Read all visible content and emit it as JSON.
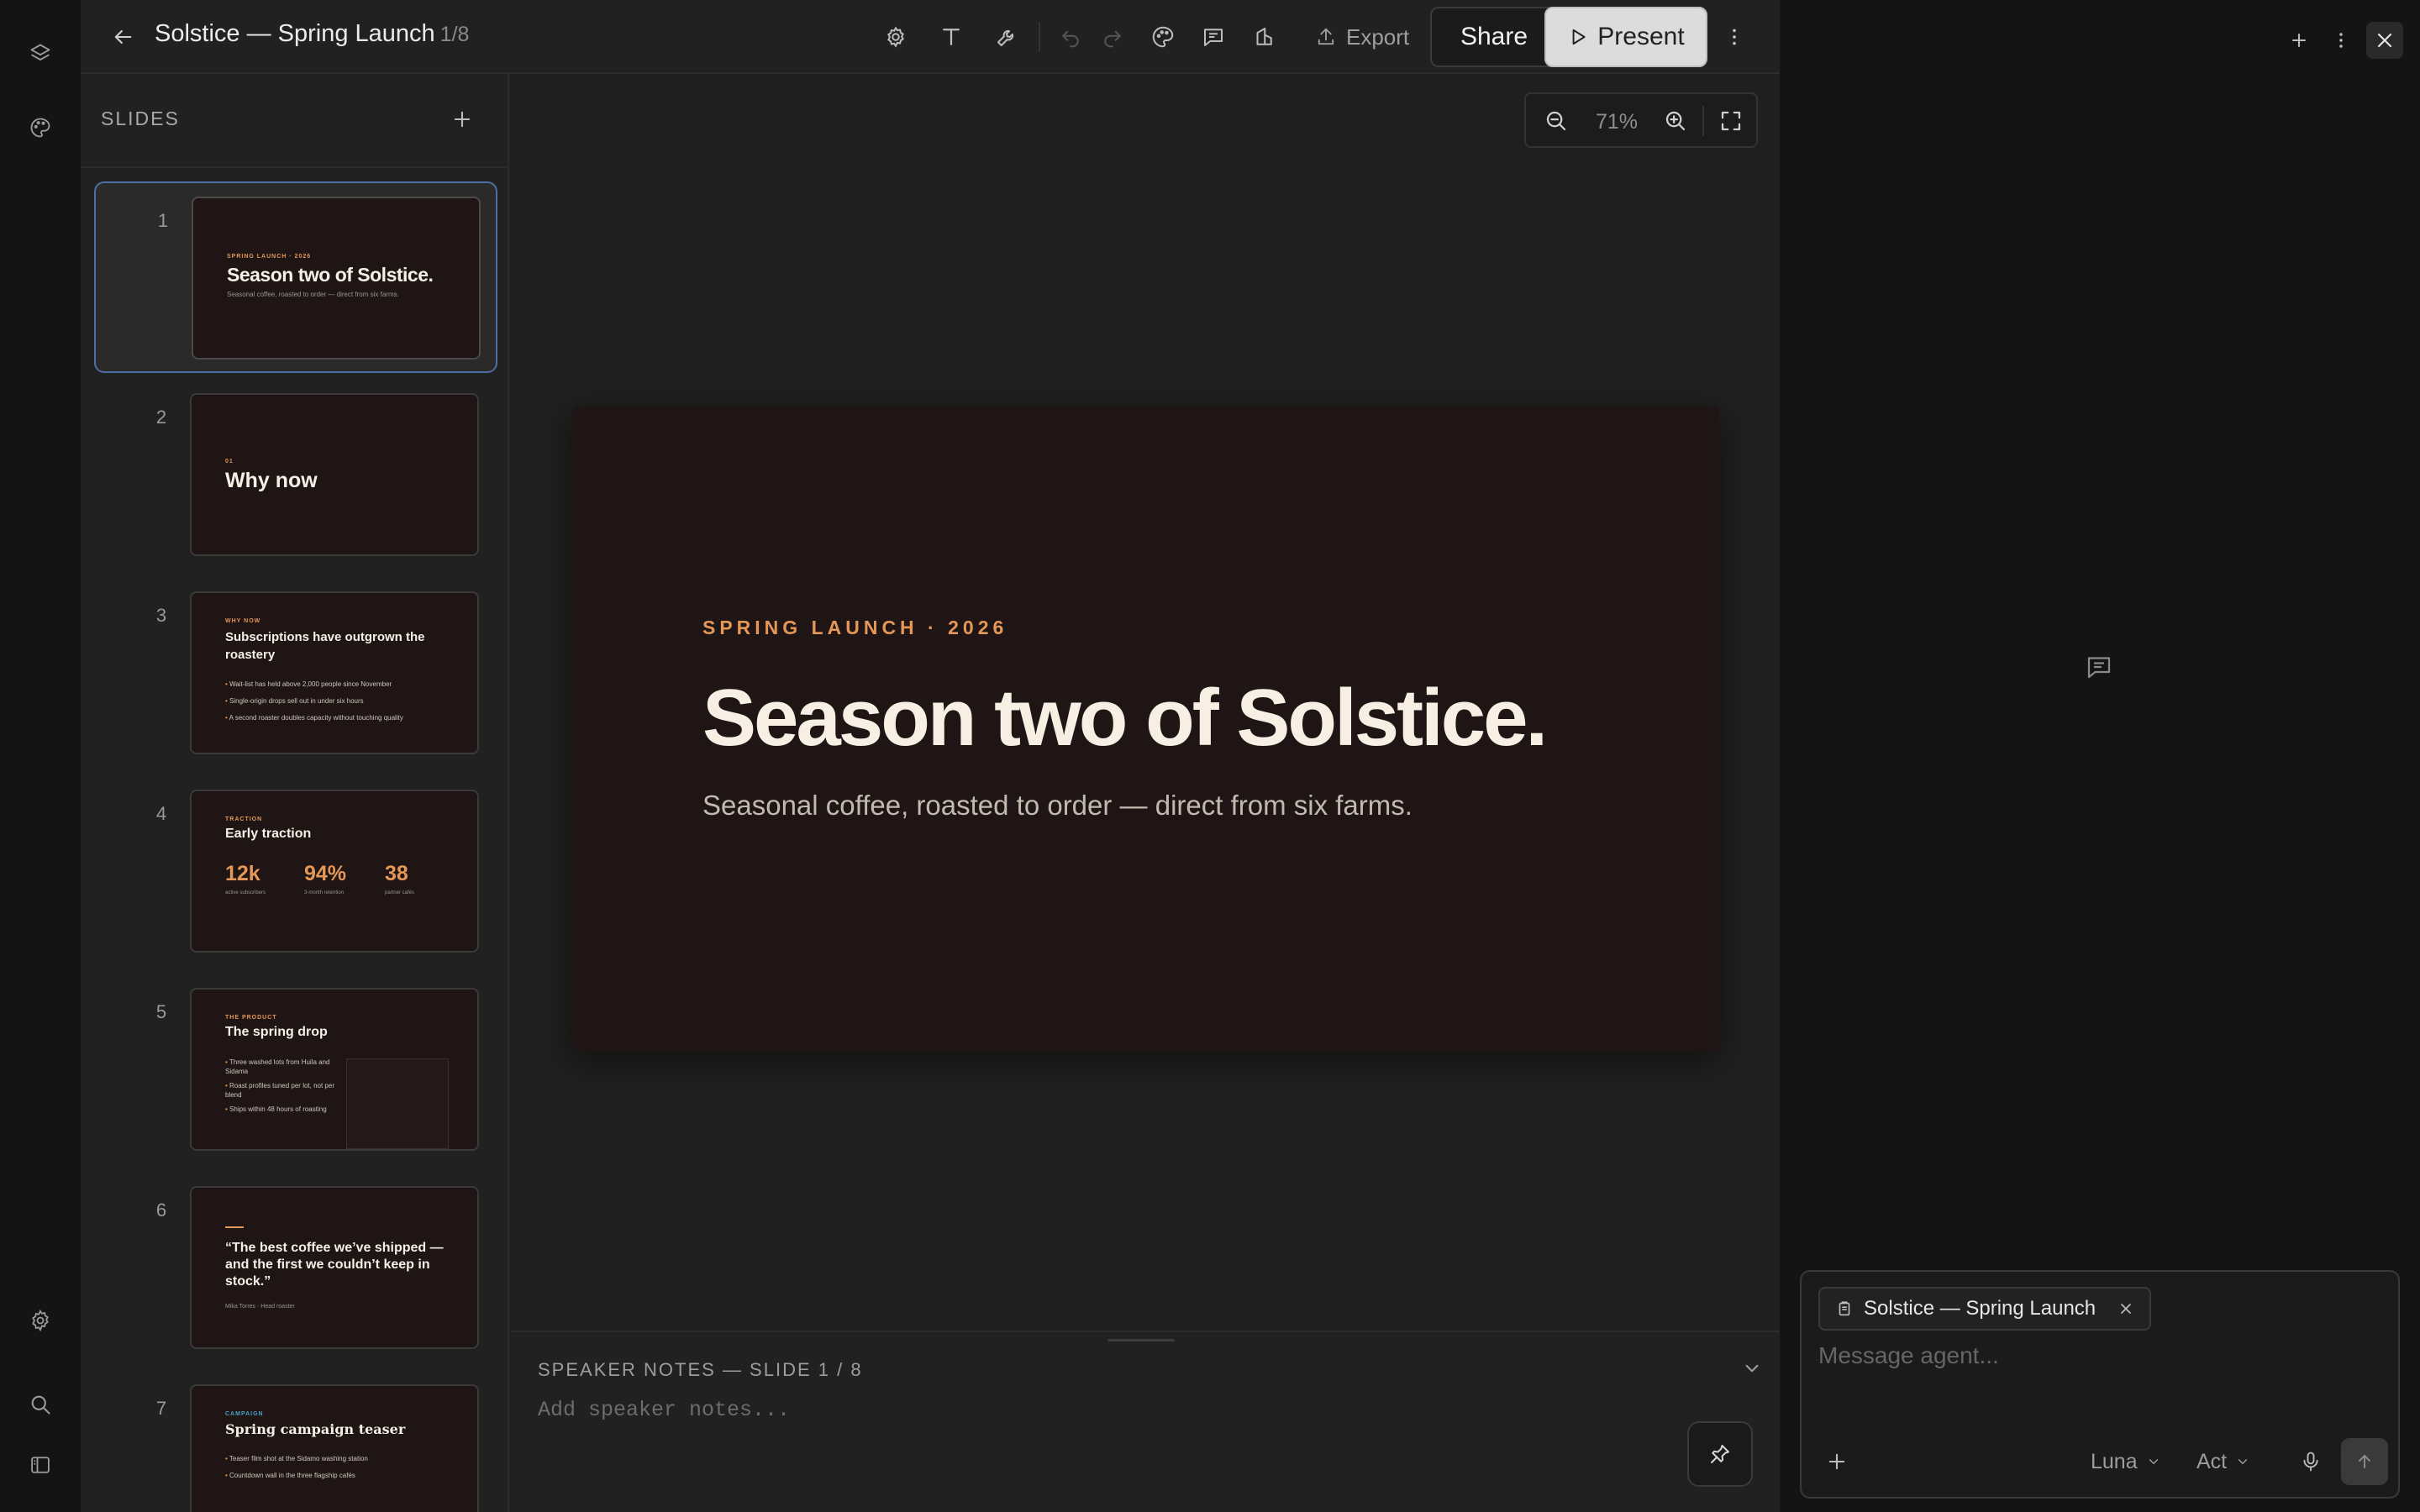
{
  "document": {
    "title": "Solstice — Spring Launch",
    "slide_count": "1/8"
  },
  "toolbar": {
    "export_label": "Export",
    "share_label": "Share",
    "present_label": "Present"
  },
  "slides_panel": {
    "label": "SLIDES",
    "slides": [
      {
        "num": "1",
        "kicker": "SPRING LAUNCH · 2026",
        "title": "Season two of Solstice.",
        "subtitle": "Seasonal coffee, roasted to order — direct from six farms."
      },
      {
        "num": "2",
        "kicker": "01",
        "title": "Why now"
      },
      {
        "num": "3",
        "kicker": "WHY NOW",
        "title": "Subscriptions have outgrown the roastery",
        "bullets": [
          "Wait-list has held above 2,000 people since November",
          "Single-origin drops sell out in under six hours",
          "A second roaster doubles capacity without touching quality"
        ]
      },
      {
        "num": "4",
        "kicker": "TRACTION",
        "title": "Early traction",
        "stats": [
          {
            "value": "12k",
            "label": "active subscribers"
          },
          {
            "value": "94%",
            "label": "3-month retention"
          },
          {
            "value": "38",
            "label": "partner cafés"
          }
        ]
      },
      {
        "num": "5",
        "kicker": "THE PRODUCT",
        "title": "The spring drop",
        "bullets": [
          "Three washed lots from Huila and Sidama",
          "Roast profiles tuned per lot, not per blend",
          "Ships within 48 hours of roasting"
        ]
      },
      {
        "num": "6",
        "quote": "“The best coffee we’ve shipped — and the first we couldn’t keep in stock.”",
        "attribution": "Mika Torres · Head roaster"
      },
      {
        "num": "7",
        "kicker": "CAMPAIGN",
        "title": "Spring campaign teaser",
        "bullets": [
          "Teaser film shot at the Sidamo washing station",
          "Countdown wall in the three flagship cafés"
        ]
      }
    ]
  },
  "canvas": {
    "zoom": "71%",
    "slide": {
      "kicker": "SPRING LAUNCH · 2026",
      "title": "Season two of Solstice.",
      "subtitle": "Seasonal coffee, roasted to order — direct from six farms."
    }
  },
  "notes": {
    "label": "SPEAKER NOTES — SLIDE 1 / 8",
    "placeholder": "Add speaker notes..."
  },
  "agent": {
    "context_chip": "Solstice — Spring Launch",
    "placeholder": "Message agent...",
    "model": "Luna",
    "mode": "Act"
  },
  "colors": {
    "accent": "#e59758",
    "slide_bg": "#1e1514",
    "selection": "#4d6ea3"
  }
}
